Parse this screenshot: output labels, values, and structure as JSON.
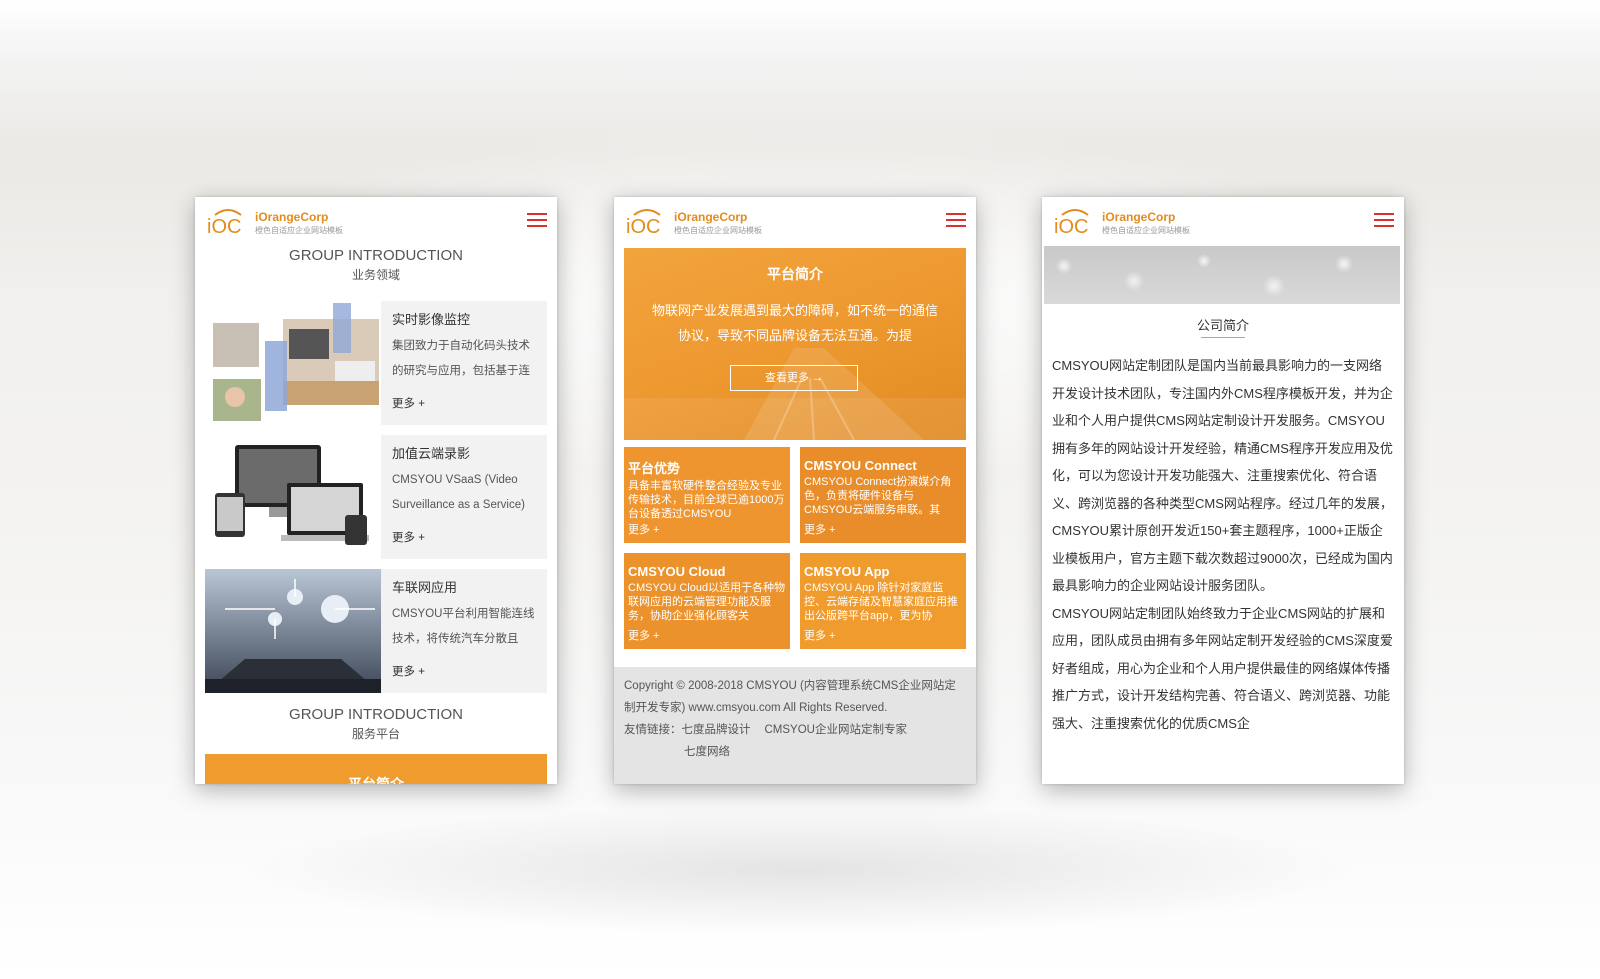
{
  "header": {
    "brand": "iOrangeCorp",
    "brand_sub": "橙色自适应企业网站模板"
  },
  "phone1": {
    "section_title": "GROUP INTRODUCTION",
    "section_sub": "业务领域",
    "items": [
      {
        "title": "实时影像监控",
        "desc": "集团致力于自动化码头技术的研究与应用，包括基于连",
        "more": "更多 +"
      },
      {
        "title": "加值云端录影",
        "desc": "CMSYOU VSaaS (Video Surveillance as a Service)",
        "more": "更多 +"
      },
      {
        "title": "车联网应用",
        "desc": "CMSYOU平台利用智能连线技术，将传统汽车分散且",
        "more": "更多 +"
      }
    ],
    "section2_title": "GROUP INTRODUCTION",
    "section2_sub": "服务平台",
    "bar_label": "平台简介"
  },
  "phone2": {
    "hero_title": "平台简介",
    "hero_text": "物联网产业发展遇到最大的障碍，如不统一的通信协议，导致不同品牌设备无法互通。为提",
    "hero_button": "查看更多 →",
    "tiles": [
      {
        "title": "平台优势",
        "desc": "具备丰富软硬件整合经验及专业传输技术，目前全球已逾1000万台设备透过CMSYOU",
        "more": "更多 +"
      },
      {
        "title": "CMSYOU Connect",
        "desc": "CMSYOU Connect扮演媒介角色，负责将硬件设备与CMSYOU云端服务串联。其",
        "more": "更多 +"
      },
      {
        "title": "CMSYOU Cloud",
        "desc": "CMSYOU Cloud以适用于各种物联网应用的云端管理功能及服务，协助企业强化顾客关",
        "more": "更多 +"
      },
      {
        "title": "CMSYOU App",
        "desc": "CMSYOU App 除针对家庭监控、云端存储及智慧家庭应用推出公版跨平台app，更为协",
        "more": "更多 +"
      }
    ],
    "footer_copyright": "Copyright © 2008-2018 CMSYOU (内容管理系统CMS企业网站定制开发专家) www.cmsyou.com All Rights Reserved.",
    "footer_links_label": "友情链接：",
    "footer_links": [
      "七度品牌设计",
      "CMSYOU企业网站定制专家",
      "七度网络"
    ]
  },
  "phone3": {
    "about_title": "公司简介",
    "paragraphs": [
      "CMSYOU网站定制团队是国内当前最具影响力的一支网络开发设计技术团队，专注国内外CMS程序模板开发，并为企业和个人用户提供CMS网站定制设计开发服务。CMSYOU拥有多年的网站设计开发经验，精通CMS程序开发应用及优化，可以为您设计开发功能强大、注重搜索优化、符合语义、跨浏览器的各种类型CMS网站程序。经过几年的发展，CMSYOU累计原创开发近150+套主题程序，1000+正版企业模板用户，官方主题下载次数超过9000次，已经成为国内最具影响力的企业网站设计服务团队。",
      "CMSYOU网站定制团队始终致力于企业CMS网站的扩展和应用，团队成员由拥有多年网站定制开发经验的CMS深度爱好者组成，用心为企业和个人用户提供最佳的网络媒体传播推广方式，设计开发结构完善、符合语义、跨浏览器、功能强大、注重搜索优化的优质CMS企"
    ]
  },
  "colors": {
    "orange": "#f09b2e",
    "menu_red": "#d9322e",
    "brand": "#e38b1d"
  }
}
